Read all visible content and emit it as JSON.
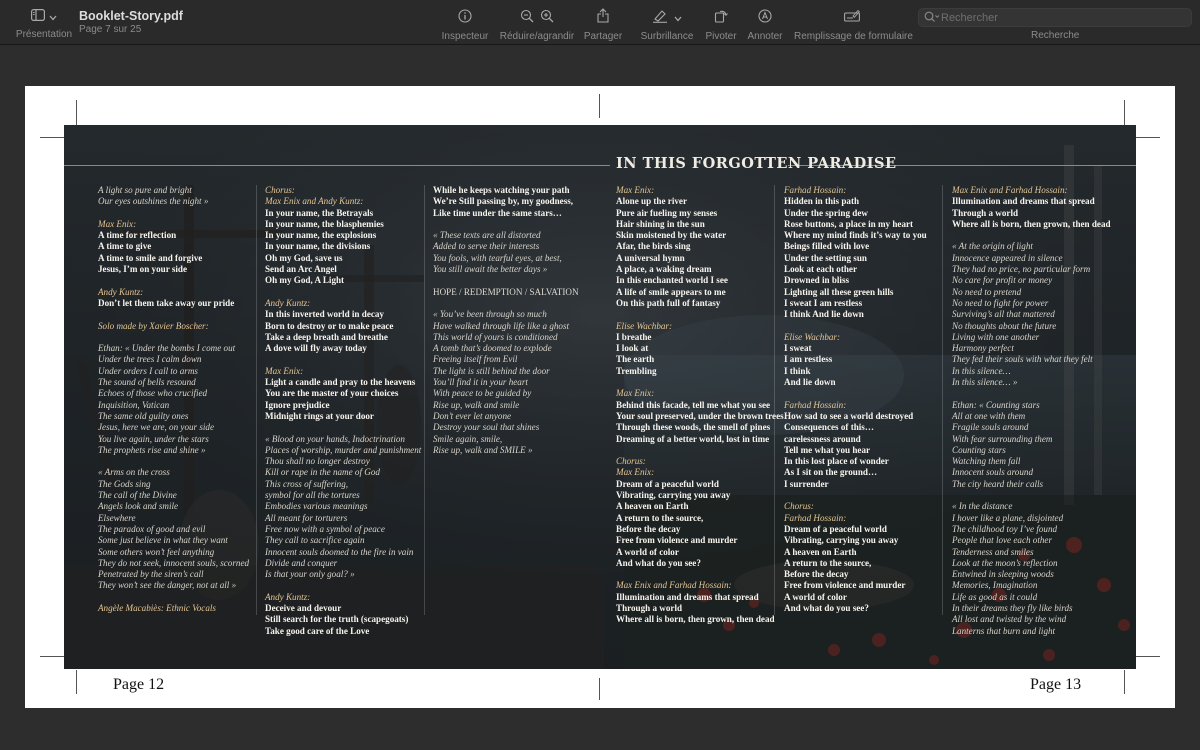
{
  "toolbar": {
    "sidebar_label": "Présentation",
    "doc_name": "Booklet-Story.pdf",
    "page_info": "Page 7 sur 25",
    "tools": [
      {
        "name": "inspector",
        "label": "Inspecteur",
        "icon": "info-icon"
      },
      {
        "name": "zoom",
        "label": "Réduire/agrandir",
        "icon": "zoom-icons"
      },
      {
        "name": "share",
        "label": "Partager",
        "icon": "share-icon"
      },
      {
        "name": "highlight",
        "label": "Surbrillance",
        "icon": "highlighter-icon"
      },
      {
        "name": "rotate",
        "label": "Pivoter",
        "icon": "rotate-icon"
      },
      {
        "name": "annotate",
        "label": "Annoter",
        "icon": "markup-icon"
      },
      {
        "name": "form-fill",
        "label": "Remplissage de formulaire",
        "icon": "form-icon"
      }
    ],
    "search_placeholder": "Rechercher",
    "search_label": "Recherche"
  },
  "spread": {
    "title": "IN THIS FORGOTTEN PARADISE",
    "page_left": "Page 12",
    "page_right": "Page 13",
    "columns": [
      [
        {
          "t": "A light so pure and bright",
          "s": "i"
        },
        {
          "t": "Our eyes outshines the night »",
          "s": "i"
        },
        {
          "t": "",
          "s": "blank"
        },
        {
          "t": "Max Enix:",
          "s": "h"
        },
        {
          "t": "A time for reflection",
          "s": "b"
        },
        {
          "t": "A time to give",
          "s": "b"
        },
        {
          "t": "A time to smile and forgive",
          "s": "b"
        },
        {
          "t": "Jesus, I’m on your side",
          "s": "b"
        },
        {
          "t": "",
          "s": "blank"
        },
        {
          "t": "Andy Kuntz:",
          "s": "h"
        },
        {
          "t": "Don’t let them take away our pride",
          "s": "b"
        },
        {
          "t": "",
          "s": "blank"
        },
        {
          "t": "Solo made by Xavier Boscher:",
          "s": "h"
        },
        {
          "t": "",
          "s": "blank"
        },
        {
          "t": "Ethan: « Under the bombs I come out",
          "s": "i"
        },
        {
          "t": "Under the trees I calm down",
          "s": "i"
        },
        {
          "t": "Under orders I call to arms",
          "s": "i"
        },
        {
          "t": "The sound of bells resound",
          "s": "i"
        },
        {
          "t": "Echoes of those who crucified",
          "s": "i"
        },
        {
          "t": "Inquisition, Vatican",
          "s": "i"
        },
        {
          "t": "The same old guilty ones",
          "s": "i"
        },
        {
          "t": "Jesus, here we are, on your side",
          "s": "i"
        },
        {
          "t": "You live again, under the stars",
          "s": "i"
        },
        {
          "t": "The prophets rise and shine »",
          "s": "i"
        },
        {
          "t": "",
          "s": "blank"
        },
        {
          "t": "« Arms on the cross",
          "s": "i"
        },
        {
          "t": "The Gods sing",
          "s": "i"
        },
        {
          "t": "The call of the Divine",
          "s": "i"
        },
        {
          "t": "Angels look and smile",
          "s": "i"
        },
        {
          "t": "Elsewhere",
          "s": "i"
        },
        {
          "t": "The paradox of good and evil",
          "s": "i"
        },
        {
          "t": "Some just believe in what they want",
          "s": "i"
        },
        {
          "t": "Some others won’t feel anything",
          "s": "i"
        },
        {
          "t": "They do not seek, innocent souls, scorned",
          "s": "i"
        },
        {
          "t": "Penetrated by the siren’s call",
          "s": "i"
        },
        {
          "t": "They won’t see the danger, not at all »",
          "s": "i"
        },
        {
          "t": "",
          "s": "blank"
        },
        {
          "t": "Angèle Macabiès: Ethnic Vocals",
          "s": "h"
        }
      ],
      [
        {
          "t": "Chorus:",
          "s": "h"
        },
        {
          "t": "Max Enix and Andy Kuntz:",
          "s": "h"
        },
        {
          "t": "In your name, the Betrayals",
          "s": "b"
        },
        {
          "t": "In your name, the blasphemies",
          "s": "b"
        },
        {
          "t": "In your name, the explosions",
          "s": "b"
        },
        {
          "t": "In your name, the divisions",
          "s": "b"
        },
        {
          "t": "Oh my God, save us",
          "s": "b"
        },
        {
          "t": "Send an Arc Angel",
          "s": "b"
        },
        {
          "t": "Oh my God, A Light",
          "s": "b"
        },
        {
          "t": "",
          "s": "blank"
        },
        {
          "t": "Andy Kuntz:",
          "s": "h"
        },
        {
          "t": "In this inverted world in decay",
          "s": "b"
        },
        {
          "t": "Born to destroy or to make peace",
          "s": "b"
        },
        {
          "t": "Take a deep breath and breathe",
          "s": "b"
        },
        {
          "t": "A dove will fly away today",
          "s": "b"
        },
        {
          "t": "",
          "s": "blank"
        },
        {
          "t": "Max Enix:",
          "s": "h"
        },
        {
          "t": "Light a candle and pray to the heavens",
          "s": "b"
        },
        {
          "t": "You are the master of your choices",
          "s": "b"
        },
        {
          "t": "Ignore prejudice",
          "s": "b"
        },
        {
          "t": "Midnight rings at your door",
          "s": "b"
        },
        {
          "t": "",
          "s": "blank"
        },
        {
          "t": "« Blood on your hands, Indoctrination",
          "s": "i"
        },
        {
          "t": "Places of worship, murder and punishment",
          "s": "i"
        },
        {
          "t": "Thou shall no longer destroy",
          "s": "i"
        },
        {
          "t": "Kill or rape in the name of God",
          "s": "i"
        },
        {
          "t": "This cross of suffering,",
          "s": "i"
        },
        {
          "t": "symbol for all the tortures",
          "s": "i"
        },
        {
          "t": "Embodies various meanings",
          "s": "i"
        },
        {
          "t": "All meant for torturers",
          "s": "i"
        },
        {
          "t": "Free now with a symbol of peace",
          "s": "i"
        },
        {
          "t": "They call to sacrifice again",
          "s": "i"
        },
        {
          "t": "Innocent souls doomed to the fire in vain",
          "s": "i"
        },
        {
          "t": "Divide and conquer",
          "s": "i"
        },
        {
          "t": "Is that your only goal? »",
          "s": "i"
        },
        {
          "t": "",
          "s": "blank"
        },
        {
          "t": "Andy Kuntz:",
          "s": "h"
        },
        {
          "t": "Deceive and devour",
          "s": "b"
        },
        {
          "t": "Still search for the truth (scapegoats)",
          "s": "b"
        },
        {
          "t": "Take good care of the Love",
          "s": "b"
        }
      ],
      [
        {
          "t": "While he keeps watching your path",
          "s": "b"
        },
        {
          "t": "We’re Still passing by, my goodness,",
          "s": "b"
        },
        {
          "t": "Like time under the same stars…",
          "s": "b"
        },
        {
          "t": "",
          "s": "blank"
        },
        {
          "t": "« These texts are all distorted",
          "s": "i"
        },
        {
          "t": "Added to serve their interests",
          "s": "i"
        },
        {
          "t": "You fools, with tearful eyes, at best,",
          "s": "i"
        },
        {
          "t": "You still await the better days »",
          "s": "i"
        },
        {
          "t": "",
          "s": "blank"
        },
        {
          "t": "HOPE / REDEMPTION / SALVATION",
          "s": "n"
        },
        {
          "t": "",
          "s": "blank"
        },
        {
          "t": "« You’ve been through so much",
          "s": "i"
        },
        {
          "t": "Have walked through life like a ghost",
          "s": "i"
        },
        {
          "t": "This world of yours is conditioned",
          "s": "i"
        },
        {
          "t": "A tomb that’s doomed to explode",
          "s": "i"
        },
        {
          "t": "Freeing itself from Evil",
          "s": "i"
        },
        {
          "t": "The light is still behind the door",
          "s": "i"
        },
        {
          "t": "You’ll find it in your heart",
          "s": "i"
        },
        {
          "t": "With peace to be guided by",
          "s": "i"
        },
        {
          "t": "Rise up, walk and smile",
          "s": "i"
        },
        {
          "t": "Don’t ever let anyone",
          "s": "i"
        },
        {
          "t": "Destroy your soul that shines",
          "s": "i"
        },
        {
          "t": "Smile again, smile,",
          "s": "i"
        },
        {
          "t": "Rise up, walk and SMILE »",
          "s": "i"
        }
      ],
      [
        {
          "t": "Max Enix:",
          "s": "h"
        },
        {
          "t": "Alone up the river",
          "s": "b"
        },
        {
          "t": "Pure air fueling my senses",
          "s": "b"
        },
        {
          "t": "Hair shining in the sun",
          "s": "b"
        },
        {
          "t": "Skin moistened by the water",
          "s": "b"
        },
        {
          "t": "Afar, the birds sing",
          "s": "b"
        },
        {
          "t": "A universal hymn",
          "s": "b"
        },
        {
          "t": "A place, a waking dream",
          "s": "b"
        },
        {
          "t": "In this enchanted world I see",
          "s": "b"
        },
        {
          "t": "A life of smile appears to me",
          "s": "b"
        },
        {
          "t": "On this path full of fantasy",
          "s": "b"
        },
        {
          "t": "",
          "s": "blank"
        },
        {
          "t": "Elise Wachbar:",
          "s": "h"
        },
        {
          "t": "I breathe",
          "s": "b"
        },
        {
          "t": "I look at",
          "s": "b"
        },
        {
          "t": "The earth",
          "s": "b"
        },
        {
          "t": "Trembling",
          "s": "b"
        },
        {
          "t": "",
          "s": "blank"
        },
        {
          "t": "Max Enix:",
          "s": "h"
        },
        {
          "t": "Behind this facade, tell me what you see",
          "s": "b"
        },
        {
          "t": "Your soul preserved, under the brown trees",
          "s": "b"
        },
        {
          "t": "Through these woods, the smell of pines",
          "s": "b"
        },
        {
          "t": "Dreaming of a better world, lost in time",
          "s": "b"
        },
        {
          "t": "",
          "s": "blank"
        },
        {
          "t": "Chorus:",
          "s": "h"
        },
        {
          "t": "Max Enix:",
          "s": "h"
        },
        {
          "t": "Dream of a peaceful world",
          "s": "b"
        },
        {
          "t": "Vibrating, carrying you away",
          "s": "b"
        },
        {
          "t": "A heaven on Earth",
          "s": "b"
        },
        {
          "t": "A return to the source,",
          "s": "b"
        },
        {
          "t": "Before the decay",
          "s": "b"
        },
        {
          "t": "Free from violence and murder",
          "s": "b"
        },
        {
          "t": "A world of color",
          "s": "b"
        },
        {
          "t": "And what do you see?",
          "s": "b"
        },
        {
          "t": "",
          "s": "blank"
        },
        {
          "t": "Max Enix and Farhad Hossain:",
          "s": "h"
        },
        {
          "t": "Illumination and dreams that spread",
          "s": "b"
        },
        {
          "t": "Through a world",
          "s": "b"
        },
        {
          "t": "Where all is born, then grown, then dead",
          "s": "b"
        }
      ],
      [
        {
          "t": "Farhad Hossain:",
          "s": "h"
        },
        {
          "t": "Hidden in this path",
          "s": "b"
        },
        {
          "t": "Under the spring dew",
          "s": "b"
        },
        {
          "t": "Rose buttons, a place in my heart",
          "s": "b"
        },
        {
          "t": "Where my mind finds it’s way to you",
          "s": "b"
        },
        {
          "t": "Beings filled with love",
          "s": "b"
        },
        {
          "t": "Under the setting sun",
          "s": "b"
        },
        {
          "t": "Look at each other",
          "s": "b"
        },
        {
          "t": "Drowned in bliss",
          "s": "b"
        },
        {
          "t": "Lighting all these green hills",
          "s": "b"
        },
        {
          "t": "I sweat I am restless",
          "s": "b"
        },
        {
          "t": "I think And lie down",
          "s": "b"
        },
        {
          "t": "",
          "s": "blank"
        },
        {
          "t": "Elise Wachbar:",
          "s": "h"
        },
        {
          "t": "I sweat",
          "s": "b"
        },
        {
          "t": "I am restless",
          "s": "b"
        },
        {
          "t": "I think",
          "s": "b"
        },
        {
          "t": "And lie down",
          "s": "b"
        },
        {
          "t": "",
          "s": "blank"
        },
        {
          "t": "Farhad Hossain:",
          "s": "h"
        },
        {
          "t": "How sad to see a world destroyed",
          "s": "b"
        },
        {
          "t": "Consequences of this…",
          "s": "b"
        },
        {
          "t": "carelessness around",
          "s": "b"
        },
        {
          "t": "Tell me what you hear",
          "s": "b"
        },
        {
          "t": "In this lost place of wonder",
          "s": "b"
        },
        {
          "t": "As I sit on the ground…",
          "s": "b"
        },
        {
          "t": "I surrender",
          "s": "b"
        },
        {
          "t": "",
          "s": "blank"
        },
        {
          "t": "Chorus:",
          "s": "h"
        },
        {
          "t": "Farhad Hossain:",
          "s": "h"
        },
        {
          "t": "Dream of a peaceful world",
          "s": "b"
        },
        {
          "t": "Vibrating, carrying you away",
          "s": "b"
        },
        {
          "t": "A heaven on Earth",
          "s": "b"
        },
        {
          "t": "A return to the source,",
          "s": "b"
        },
        {
          "t": "Before the decay",
          "s": "b"
        },
        {
          "t": "Free from violence and murder",
          "s": "b"
        },
        {
          "t": "A world of color",
          "s": "b"
        },
        {
          "t": "And what do you see?",
          "s": "b"
        }
      ],
      [
        {
          "t": "Max Enix and Farhad Hossain:",
          "s": "h"
        },
        {
          "t": "Illumination and dreams that spread",
          "s": "b"
        },
        {
          "t": "Through a world",
          "s": "b"
        },
        {
          "t": "Where all is born, then grown, then dead",
          "s": "b"
        },
        {
          "t": "",
          "s": "blank"
        },
        {
          "t": "« At the origin of light",
          "s": "i"
        },
        {
          "t": "Innocence appeared in silence",
          "s": "i"
        },
        {
          "t": "They had no price, no particular form",
          "s": "i"
        },
        {
          "t": "No care for profit or money",
          "s": "i"
        },
        {
          "t": "No need to pretend",
          "s": "i"
        },
        {
          "t": "No need to fight for power",
          "s": "i"
        },
        {
          "t": "Surviving’s all that mattered",
          "s": "i"
        },
        {
          "t": "No thoughts about the future",
          "s": "i"
        },
        {
          "t": "Living with one another",
          "s": "i"
        },
        {
          "t": "Harmony perfect",
          "s": "i"
        },
        {
          "t": "They fed their souls with what they felt",
          "s": "i"
        },
        {
          "t": "In this silence…",
          "s": "i"
        },
        {
          "t": "In this silence… »",
          "s": "i"
        },
        {
          "t": "",
          "s": "blank"
        },
        {
          "t": "Ethan: « Counting stars",
          "s": "i"
        },
        {
          "t": "All at one with them",
          "s": "i"
        },
        {
          "t": "Fragile souls around",
          "s": "i"
        },
        {
          "t": "With fear surrounding them",
          "s": "i"
        },
        {
          "t": "Counting stars",
          "s": "i"
        },
        {
          "t": "Watching them fall",
          "s": "i"
        },
        {
          "t": "Innocent souls around",
          "s": "i"
        },
        {
          "t": "The city heard their calls",
          "s": "i"
        },
        {
          "t": "",
          "s": "blank"
        },
        {
          "t": "« In the distance",
          "s": "i"
        },
        {
          "t": "I hover like a plane, disjointed",
          "s": "i"
        },
        {
          "t": "The childhood toy I’ve found",
          "s": "i"
        },
        {
          "t": "People that love each other",
          "s": "i"
        },
        {
          "t": "Tenderness and smiles",
          "s": "i"
        },
        {
          "t": "Look at the moon’s reflection",
          "s": "i"
        },
        {
          "t": "Entwined in sleeping woods",
          "s": "i"
        },
        {
          "t": "Memories, Imagination",
          "s": "i"
        },
        {
          "t": "Life as good as it could",
          "s": "i"
        },
        {
          "t": "In their dreams they fly like birds",
          "s": "i"
        },
        {
          "t": "All lost and twisted by the wind",
          "s": "i"
        },
        {
          "t": "Lanterns that burn and light",
          "s": "i"
        }
      ]
    ]
  }
}
